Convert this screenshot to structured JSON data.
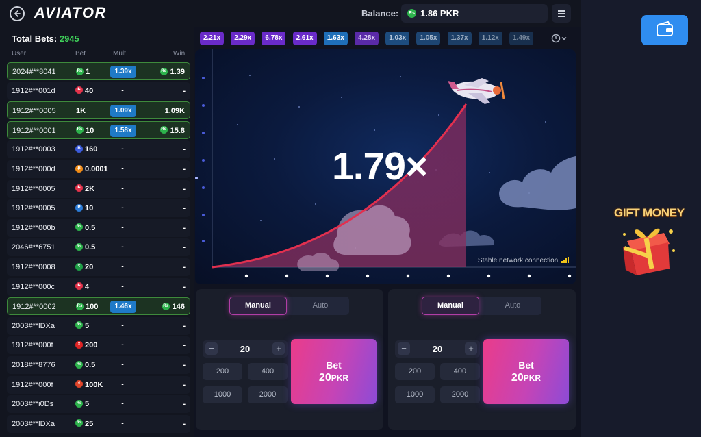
{
  "header": {
    "logo": "AVIATOR",
    "balance_label": "Balance:",
    "balance_value": "1.86 PKR",
    "currency_symbol": "Rs"
  },
  "bets_panel": {
    "total_label": "Total Bets:",
    "total_count": "2945",
    "columns": [
      "User",
      "Bet",
      "Mult.",
      "Win"
    ],
    "rows": [
      {
        "user": "2024#**8041",
        "coin": "Rs",
        "coin_color": "#2db34c",
        "bet": "1",
        "mult": "1.39x",
        "win": "1.39",
        "won": true
      },
      {
        "user": "1912#**001d",
        "coin": "₺",
        "coin_color": "#e3334b",
        "bet": "40",
        "mult": "-",
        "win": "-",
        "won": false
      },
      {
        "user": "1912#**0005",
        "coin": "",
        "coin_color": "",
        "bet": "1K",
        "mult": "1.09x",
        "win": "1.09K",
        "won": true
      },
      {
        "user": "1912#**0001",
        "coin": "Rs",
        "coin_color": "#2db34c",
        "bet": "10",
        "mult": "1.58x",
        "win": "15.8",
        "won": true
      },
      {
        "user": "1912#**0003",
        "coin": "B",
        "coin_color": "#3b5bdb",
        "bet": "160",
        "mult": "-",
        "win": "-",
        "won": false
      },
      {
        "user": "1912#**000d",
        "coin": "₿",
        "coin_color": "#f08b16",
        "bet": "0.0001",
        "mult": "-",
        "win": "-",
        "won": false
      },
      {
        "user": "1912#**0005",
        "coin": "₺",
        "coin_color": "#e3334b",
        "bet": "2K",
        "mult": "-",
        "win": "-",
        "won": false
      },
      {
        "user": "1912#**0005",
        "coin": "₱",
        "coin_color": "#2b7bd6",
        "bet": "10",
        "mult": "-",
        "win": "-",
        "won": false
      },
      {
        "user": "1912#**000b",
        "coin": "Rs",
        "coin_color": "#2db34c",
        "bet": "0.5",
        "mult": "-",
        "win": "-",
        "won": false
      },
      {
        "user": "2046#**6751",
        "coin": "Rs",
        "coin_color": "#2db34c",
        "bet": "0.5",
        "mult": "-",
        "win": "-",
        "won": false
      },
      {
        "user": "1912#**0008",
        "coin": "₹",
        "coin_color": "#1e9e46",
        "bet": "20",
        "mult": "-",
        "win": "-",
        "won": false
      },
      {
        "user": "1912#**000c",
        "coin": "₺",
        "coin_color": "#e3334b",
        "bet": "4",
        "mult": "-",
        "win": "-",
        "won": false
      },
      {
        "user": "1912#**0002",
        "coin": "Rs",
        "coin_color": "#2db34c",
        "bet": "100",
        "mult": "1.46x",
        "win": "146",
        "won": true
      },
      {
        "user": "2003#**lDXa",
        "coin": "Rs",
        "coin_color": "#2db34c",
        "bet": "5",
        "mult": "-",
        "win": "-",
        "won": false
      },
      {
        "user": "1912#**000f",
        "coin": "¥",
        "coin_color": "#e02424",
        "bet": "200",
        "mult": "-",
        "win": "-",
        "won": false
      },
      {
        "user": "2018#**8776",
        "coin": "Rs",
        "coin_color": "#2db34c",
        "bet": "0.5",
        "mult": "-",
        "win": "-",
        "won": false
      },
      {
        "user": "1912#**000f",
        "coin": "₫",
        "coin_color": "#e0452a",
        "bet": "100K",
        "mult": "-",
        "win": "-",
        "won": false
      },
      {
        "user": "2003#**i0Ds",
        "coin": "Rs",
        "coin_color": "#2db34c",
        "bet": "5",
        "mult": "-",
        "win": "-",
        "won": false
      },
      {
        "user": "2003#**lDXa",
        "coin": "Rs",
        "coin_color": "#2db34c",
        "bet": "25",
        "mult": "-",
        "win": "-",
        "won": false
      }
    ]
  },
  "history": [
    {
      "v": "2.21x",
      "bg": "#6a2bc9",
      "fg": "#ffffff"
    },
    {
      "v": "2.29x",
      "bg": "#6a2bc9",
      "fg": "#ffffff"
    },
    {
      "v": "6.78x",
      "bg": "#6a2bc9",
      "fg": "#ffffff"
    },
    {
      "v": "2.61x",
      "bg": "#6a2bc9",
      "fg": "#ffffff"
    },
    {
      "v": "1.63x",
      "bg": "#1f6fb8",
      "fg": "#ffffff"
    },
    {
      "v": "4.28x",
      "bg": "#5a2aa8",
      "fg": "#e0d4f7"
    },
    {
      "v": "1.03x",
      "bg": "#1d4c7e",
      "fg": "#b8c9dd"
    },
    {
      "v": "1.05x",
      "bg": "#1d4572",
      "fg": "#a8b9cd"
    },
    {
      "v": "1.37x",
      "bg": "#1c3e66",
      "fg": "#98a9bd"
    },
    {
      "v": "1.12x",
      "bg": "#1a3659",
      "fg": "#8899ad"
    },
    {
      "v": "1.49x",
      "bg": "#182f4d",
      "fg": "#76869a"
    }
  ],
  "game": {
    "multiplier": "1.79×",
    "network_status": "Stable network connection"
  },
  "bet_panels": [
    {
      "tab_manual": "Manual",
      "tab_auto": "Auto",
      "amount": "20",
      "minus": "−",
      "plus": "+",
      "quick": [
        "200",
        "400",
        "1000",
        "2000"
      ],
      "bet_label": "Bet",
      "bet_amount": "20",
      "bet_currency": "PKR"
    },
    {
      "tab_manual": "Manual",
      "tab_auto": "Auto",
      "amount": "20",
      "minus": "−",
      "plus": "+",
      "quick": [
        "200",
        "400",
        "1000",
        "2000"
      ],
      "bet_label": "Bet",
      "bet_amount": "20",
      "bet_currency": "PKR"
    }
  ],
  "promo": {
    "gift_label": "GIFT MONEY"
  },
  "icons": {
    "back": "arrow-left-icon",
    "menu": "hamburger-icon",
    "history": "clock-icon",
    "wallet": "wallet-icon",
    "plane": "airplane-icon",
    "gift": "gift-box-icon",
    "signal": "signal-bars-icon"
  }
}
